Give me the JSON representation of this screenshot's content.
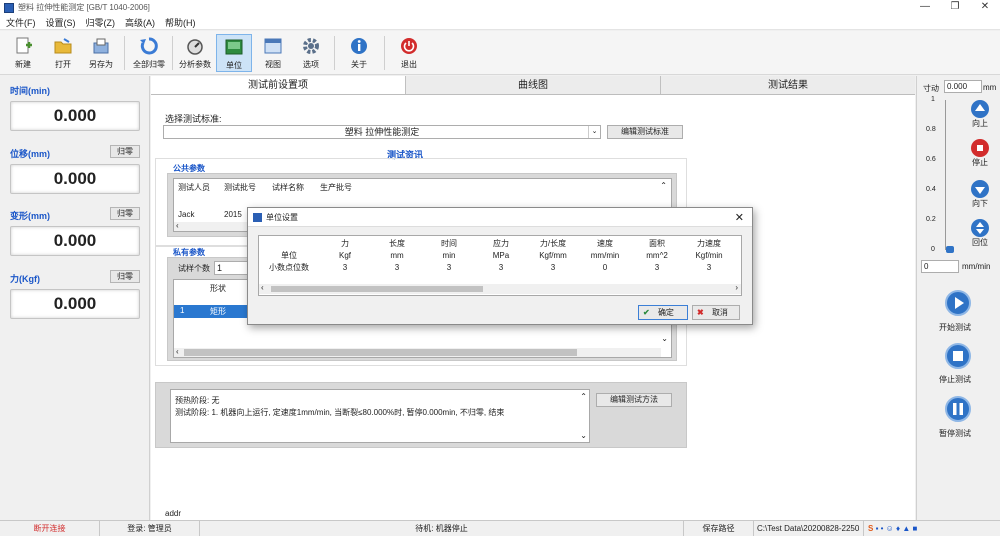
{
  "window": {
    "title": "塑料 拉伸性能测定 [GB/T 1040-2006]",
    "minimize": "—",
    "restore": "❐",
    "close": "✕"
  },
  "menu": [
    "文件(F)",
    "设置(S)",
    "归零(Z)",
    "高级(A)",
    "帮助(H)"
  ],
  "toolbar": [
    {
      "label": "新建",
      "icon": "new-file-icon",
      "color": "#4a8f2f"
    },
    {
      "label": "打开",
      "icon": "open-folder-icon",
      "color": "#e8b93a"
    },
    {
      "label": "另存为",
      "icon": "save-as-icon",
      "color": "#5b8bd0"
    },
    {
      "label": "全部归零",
      "icon": "reset-all-icon",
      "color": "#3a7bd5"
    },
    {
      "label": "分析参数",
      "icon": "analysis-params-icon",
      "color": "#6b6b6b"
    },
    {
      "label": "单位",
      "icon": "unit-icon",
      "color": "#2e8b3f"
    },
    {
      "label": "视图",
      "icon": "view-icon",
      "color": "#4a78b8"
    },
    {
      "label": "选项",
      "icon": "options-gear-icon",
      "color": "#5a6f8a"
    },
    {
      "label": "关于",
      "icon": "about-info-icon",
      "color": "#2f73c6"
    },
    {
      "label": "退出",
      "icon": "exit-power-icon",
      "color": "#d22c2c"
    }
  ],
  "sensors": [
    {
      "label": "时间(min)",
      "value": "0.000",
      "zero": ""
    },
    {
      "label": "位移(mm)",
      "value": "0.000",
      "zero": "归零"
    },
    {
      "label": "变形(mm)",
      "value": "0.000",
      "zero": "归零"
    },
    {
      "label": "力(Kgf)",
      "value": "0.000",
      "zero": "归零"
    }
  ],
  "tabs": [
    "测试前设置项",
    "曲线图",
    "测试结果"
  ],
  "setup": {
    "select_label": "选择测试标准:",
    "standard": "塑料 拉伸性能测定",
    "edit_standard_button": "编辑测试标准",
    "section_title": "测试资讯",
    "public_params": "公共参数",
    "public_headers": [
      "测试人员",
      "测试批号",
      "试样名称",
      "生产批号"
    ],
    "public_values": [
      "Jack",
      "2015"
    ],
    "private_params": "私有参数",
    "sample_count_label": "试样个数",
    "sample_count": "1",
    "private_header": "形状",
    "private_row": {
      "index": "1",
      "shape": "矩形"
    },
    "method_text_1": "预热阶段: 无",
    "method_text_2": "测试阶段: 1. 机器向上运行, 定速度1mm/min, 当断裂≤80.000%时, 暂停0.000min, 不归零, 结束",
    "edit_method_button": "编辑测试方法",
    "addr": "addr"
  },
  "right": {
    "jog_label": "寸动",
    "jog_value": "0.000",
    "jog_unit": "mm",
    "scale": [
      "1",
      "0.8",
      "0.6",
      "0.4",
      "0.2",
      "0"
    ],
    "up": "向上",
    "stop": "停止",
    "down": "向下",
    "home": "回位",
    "speed_value": "0",
    "speed_unit": "mm/min",
    "start": "开始测试",
    "stop_test": "停止测试",
    "pause": "暂停测试"
  },
  "dialog": {
    "title": "单位设置",
    "header": [
      "",
      "力",
      "长度",
      "时间",
      "应力",
      "力/长度",
      "速度",
      "面积",
      "力速度"
    ],
    "units": [
      "单位",
      "Kgf",
      "mm",
      "min",
      "MPa",
      "Kgf/mm",
      "mm/min",
      "mm^2",
      "Kgf/min"
    ],
    "decimals": [
      "小数点位数",
      "3",
      "3",
      "3",
      "3",
      "3",
      "0",
      "3",
      "3"
    ],
    "ok": "确定",
    "cancel": "取消"
  },
  "status": {
    "connection": "断开连接",
    "login": "登录: 管理员",
    "machine": "待机: 机器停止",
    "save_path_label": "保存路径",
    "save_path": "C:\\Test Data\\20200828-2250",
    "connection_color": "#d22c2c"
  }
}
